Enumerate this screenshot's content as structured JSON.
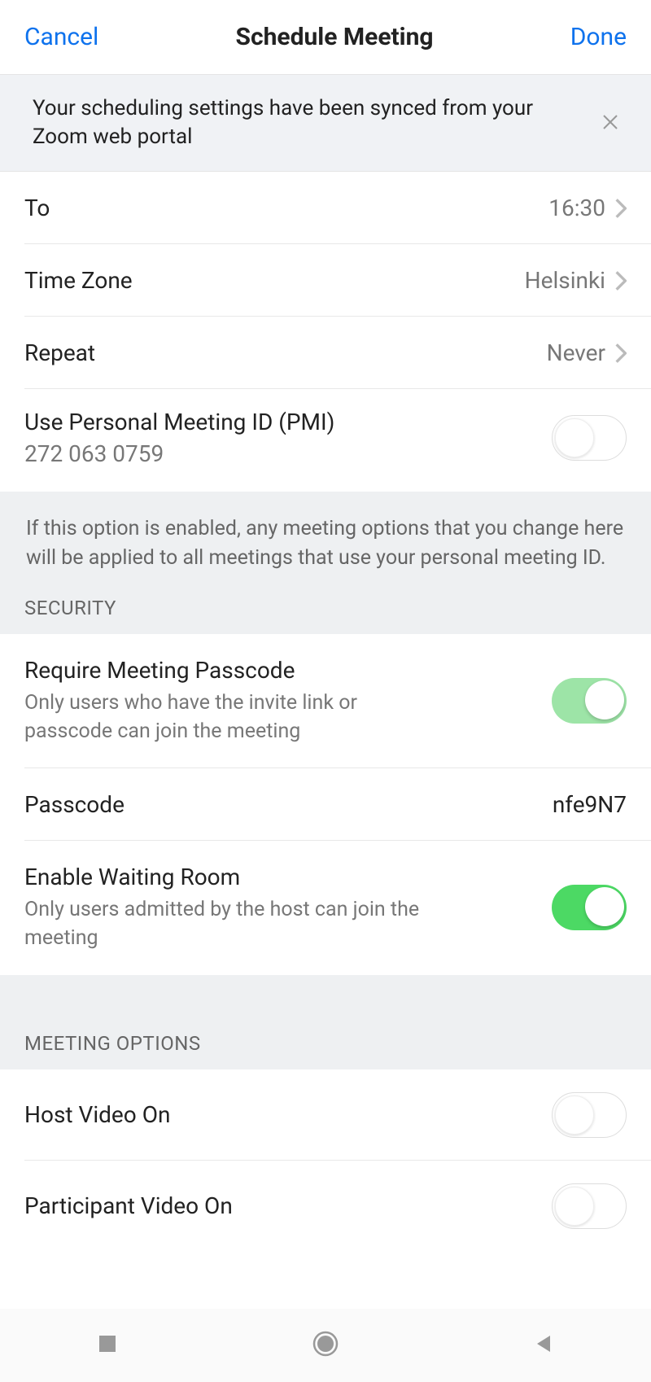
{
  "header": {
    "cancel": "Cancel",
    "title": "Schedule Meeting",
    "done": "Done"
  },
  "banner": {
    "text": "Your scheduling settings have been synced from your Zoom web portal"
  },
  "schedule": {
    "to_label": "To",
    "to_value": "16:30",
    "timezone_label": "Time Zone",
    "timezone_value": "Helsinki",
    "repeat_label": "Repeat",
    "repeat_value": "Never",
    "pmi_label": "Use Personal Meeting ID (PMI)",
    "pmi_value": "272 063 0759",
    "pmi_enabled": false
  },
  "pmi_info": "If this option is enabled, any meeting options that you change here will be applied to all meetings that use your personal meeting ID.",
  "security": {
    "header": "SECURITY",
    "require_passcode_label": "Require Meeting Passcode",
    "require_passcode_desc": "Only users who have the invite link or passcode can join the meeting",
    "require_passcode_enabled": true,
    "passcode_label": "Passcode",
    "passcode_value": "nfe9N7",
    "waiting_room_label": "Enable Waiting Room",
    "waiting_room_desc": "Only users admitted by the host can join the meeting",
    "waiting_room_enabled": true
  },
  "meeting_options": {
    "header": "MEETING OPTIONS",
    "host_video_label": "Host Video On",
    "host_video_enabled": false,
    "participant_video_label": "Participant Video On",
    "participant_video_enabled": false
  }
}
